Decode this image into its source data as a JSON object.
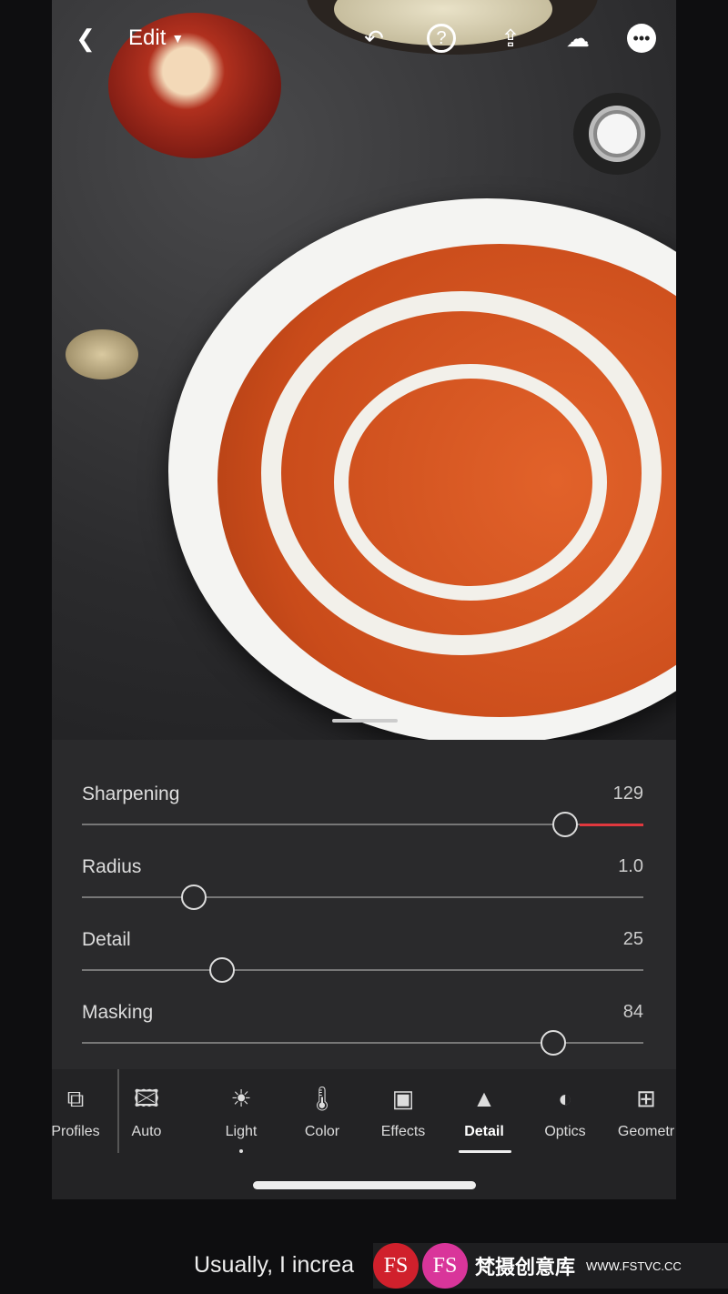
{
  "toolbar": {
    "back_icon": "chevron-left",
    "mode": "Edit",
    "icons": [
      "undo-icon",
      "help-icon",
      "share-icon",
      "cloud-alert-icon",
      "more-icon"
    ]
  },
  "sliders": [
    {
      "label": "Sharpening",
      "value": "129",
      "min": 0,
      "max": 150,
      "num": 129,
      "accent": "#e0383e"
    },
    {
      "label": "Radius",
      "value": "1.0",
      "min": 0.5,
      "max": 3,
      "num": 1.0
    },
    {
      "label": "Detail",
      "value": "25",
      "min": 0,
      "max": 100,
      "num": 25
    },
    {
      "label": "Masking",
      "value": "84",
      "min": 0,
      "max": 100,
      "num": 84
    }
  ],
  "tools": [
    {
      "label": "Profiles",
      "icon": "⧉"
    },
    {
      "label": "Auto",
      "icon": "🖾"
    },
    {
      "label": "Light",
      "icon": "☀"
    },
    {
      "label": "Color",
      "icon": "🌡"
    },
    {
      "label": "Effects",
      "icon": "▣"
    },
    {
      "label": "Detail",
      "icon": "▲",
      "active": true
    },
    {
      "label": "Optics",
      "icon": "◐"
    },
    {
      "label": "Geometr",
      "icon": "⊞"
    }
  ],
  "caption": "Usually, I increa",
  "watermark": {
    "logo": "FS",
    "text": "梵摄创意库",
    "url": "WWW.FSTVC.CC"
  }
}
